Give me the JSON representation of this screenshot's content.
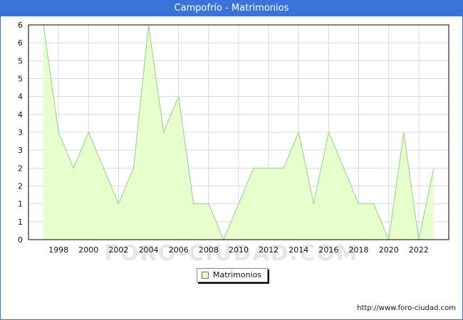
{
  "window": {
    "title": "Campofrío - Matrimonios"
  },
  "watermark": "FORO-CIUDAD.COM",
  "footer": {
    "url": "http://www.foro-ciudad.com"
  },
  "colors": {
    "fill": "#e6ffcc",
    "line": "#8fd08f",
    "title_bar": "#3a74db",
    "grid": "#d8d8d8"
  },
  "chart_data": {
    "type": "area",
    "title": "Campofrío - Matrimonios",
    "x": [
      1997,
      1998,
      1999,
      2000,
      2001,
      2002,
      2003,
      2004,
      2005,
      2006,
      2007,
      2008,
      2009,
      2010,
      2011,
      2012,
      2013,
      2014,
      2015,
      2016,
      2017,
      2018,
      2019,
      2020,
      2021,
      2022,
      2023
    ],
    "series": [
      {
        "name": "Matrimonios",
        "values": [
          6,
          3,
          2,
          3,
          2,
          1,
          2,
          6,
          3,
          4,
          1,
          1,
          0,
          1,
          2,
          2,
          2,
          3,
          1,
          3,
          2,
          1,
          1,
          0,
          3,
          0,
          2
        ]
      }
    ],
    "x_ticks": [
      "1998",
      "2000",
      "2002",
      "2004",
      "2006",
      "2008",
      "2010",
      "2012",
      "2014",
      "2016",
      "2018",
      "2020",
      "2022"
    ],
    "y_ticks": [
      "0",
      "1",
      "1",
      "2",
      "2",
      "3",
      "3",
      "4",
      "4",
      "5",
      "5",
      "6",
      "6"
    ],
    "xlabel": "",
    "ylabel": "",
    "xlim": [
      1996,
      2024
    ],
    "ylim": [
      0,
      6
    ],
    "grid": true,
    "legend": "bottom-center"
  }
}
